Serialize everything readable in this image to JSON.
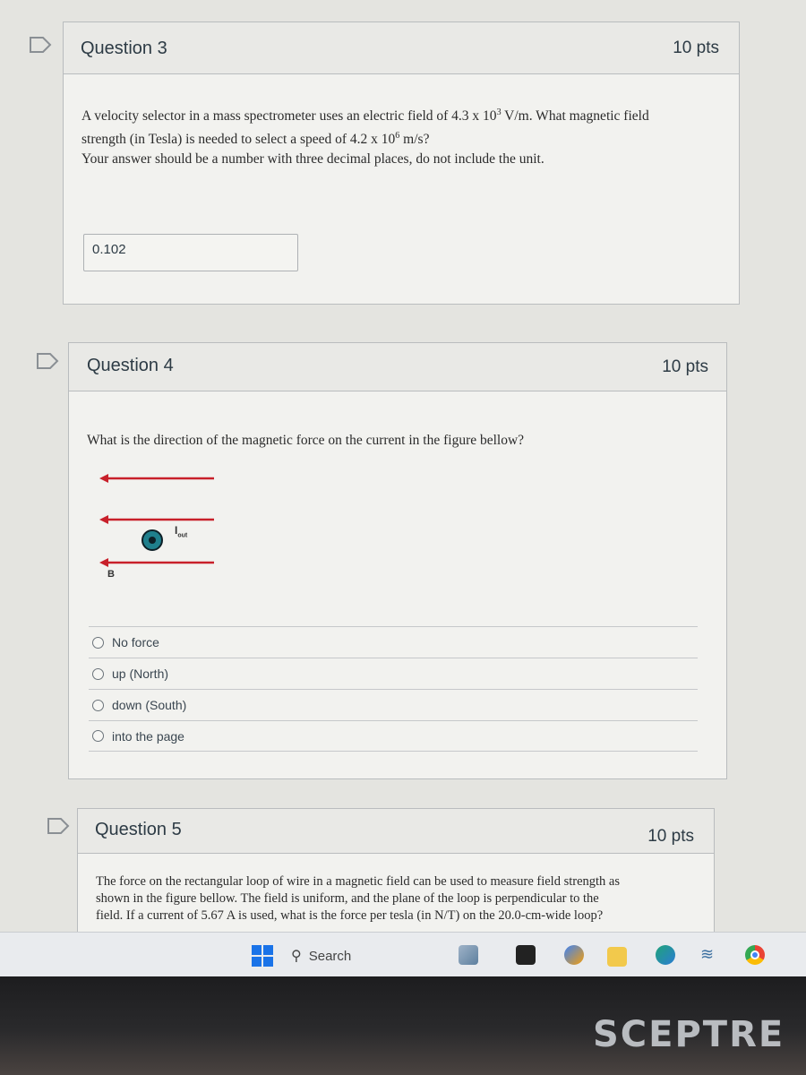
{
  "questions": [
    {
      "title": "Question 3",
      "points": "10 pts",
      "text_line1": "A velocity selector in a mass spectrometer uses an electric field of 4.3 x 10",
      "text_line1_sup": "3",
      "text_line1_end": " V/m. What magnetic field",
      "text_line2": "strength (in Tesla) is needed to select a speed of 4.2 x 10",
      "text_line2_sup": "6",
      "text_line2_end": " m/s?",
      "text_line3": "Your answer should be a number with three decimal places, do not include the unit.",
      "answer": "0.102"
    },
    {
      "title": "Question 4",
      "points": "10 pts",
      "text": "What is the direction of the magnetic force on the current in the figure bellow?",
      "figure": {
        "field_label": "B",
        "current_label": "I",
        "current_label_sub": "out",
        "field_line_color": "#c8202a",
        "current_symbol_color": "#1f7f8c"
      },
      "options": [
        "No force",
        "up (North)",
        "down (South)",
        "into the page"
      ]
    },
    {
      "title": "Question 5",
      "points": "10 pts",
      "text_line1": "The force on the rectangular loop of wire in a magnetic field can be used to measure field strength as",
      "text_line2": "shown in the figure bellow. The field is uniform, and the plane of the loop is perpendicular to the",
      "text_line3": "field. If a current of 5.67 A is used, what is the force per tesla (in N/T) on the 20.0-cm-wide loop?"
    }
  ],
  "taskbar": {
    "search_placeholder": "Search",
    "icons": [
      "windows-start-icon",
      "search-icon",
      "files-icon",
      "terminal-icon",
      "copilot-icon",
      "file-explorer-icon",
      "edge-icon",
      "widgets-icon",
      "chrome-icon"
    ]
  },
  "monitor": {
    "brand": "SCEPTRE"
  }
}
